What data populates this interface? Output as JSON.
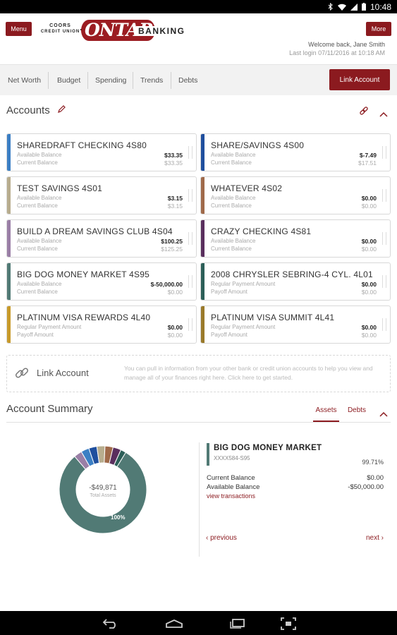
{
  "status_bar": {
    "time": "10:48"
  },
  "header": {
    "menu_label": "Menu",
    "more_label": "More",
    "logo_coors": "COORS",
    "logo_credit_union": "CREDIT UNION",
    "logo_ontap": "ONTAP",
    "logo_banking": "BANKING",
    "welcome": "Welcome back, Jane Smith",
    "last_login": "Last login 07/11/2016 at 10:18 AM"
  },
  "nav": {
    "items": [
      "Net Worth",
      "Budget",
      "Spending",
      "Trends",
      "Debts"
    ],
    "link_account_button": "Link Account"
  },
  "accounts": {
    "title": "Accounts",
    "cards": [
      {
        "name": "SHAREDRAFT CHECKING  4S80",
        "label1": "Available Balance",
        "value1": "$33.35",
        "label2": "Current Balance",
        "value2": "$33.35",
        "color": "#3b7fc4"
      },
      {
        "name": "SHARE/SAVINGS  4S00",
        "label1": "Available Balance",
        "value1": "$-7.49",
        "label2": "Current Balance",
        "value2": "$17.51",
        "color": "#1f4f9e"
      },
      {
        "name": "TEST SAVINGS  4S01",
        "label1": "Available Balance",
        "value1": "$3.15",
        "label2": "Current Balance",
        "value2": "$3.15",
        "color": "#b8ad8e"
      },
      {
        "name": "WHATEVER  4S02",
        "label1": "Available Balance",
        "value1": "$0.00",
        "label2": "Current Balance",
        "value2": "$0.00",
        "color": "#a06a4a"
      },
      {
        "name": "BUILD A DREAM SAVINGS CLUB  4S04",
        "label1": "Available Balance",
        "value1": "$100.25",
        "label2": "Current Balance",
        "value2": "$125.25",
        "color": "#9a7fa6"
      },
      {
        "name": "CRAZY CHECKING  4S81",
        "label1": "Available Balance",
        "value1": "$0.00",
        "label2": "Current Balance",
        "value2": "$0.00",
        "color": "#5a2f5e"
      },
      {
        "name": "BIG DOG MONEY MARKET  4S95",
        "label1": "Available Balance",
        "value1": "$-50,000.00",
        "label2": "Current Balance",
        "value2": "$0.00",
        "color": "#517a75"
      },
      {
        "name": "2008 CHRYSLER SEBRING-4 CYL.  4L01",
        "label1": "Regular Payment Amount",
        "value1": "$0.00",
        "label2": "Payoff Amount",
        "value2": "$0.00",
        "color": "#2c5f58"
      },
      {
        "name": "PLATINUM VISA REWARDS  4L40",
        "label1": "Regular Payment Amount",
        "value1": "$0.00",
        "label2": "Payoff Amount",
        "value2": "$0.00",
        "color": "#c89a2a"
      },
      {
        "name": "PLATINUM VISA SUMMIT  4L41",
        "label1": "Regular Payment Amount",
        "value1": "$0.00",
        "label2": "Payoff Amount",
        "value2": "$0.00",
        "color": "#9a7a2a"
      }
    ]
  },
  "link_row": {
    "label": "Link Account",
    "description": "You can pull in information from your other bank or credit union accounts to help you view and manage all of your finances right here. Click here to get started."
  },
  "summary": {
    "title": "Account Summary",
    "tab_assets": "Assets",
    "tab_debts": "Debts",
    "donut_total": "-$49,871",
    "donut_sub": "Total Assets",
    "donut_pct": "100%",
    "donut_segments": [
      {
        "fraction": 0.8,
        "color": "#517a75"
      },
      {
        "fraction": 0.03,
        "color": "#9a7fa6"
      },
      {
        "fraction": 0.03,
        "color": "#3b7fc4"
      },
      {
        "fraction": 0.03,
        "color": "#1f4f9e"
      },
      {
        "fraction": 0.03,
        "color": "#b8ad8e"
      },
      {
        "fraction": 0.03,
        "color": "#a06a4a"
      },
      {
        "fraction": 0.03,
        "color": "#5a2f5e"
      },
      {
        "fraction": 0.02,
        "color": "#2c5f58"
      }
    ],
    "detail": {
      "name": "BIG DOG MONEY MARKET",
      "account": "XXXX584-S95",
      "percent": "99.71%",
      "current_label": "Current Balance",
      "current_value": "$0.00",
      "available_label": "Available Balance",
      "available_value": "-$50,000.00",
      "view_transactions": "view transactions"
    },
    "prev_label": "previous",
    "next_label": "next"
  }
}
